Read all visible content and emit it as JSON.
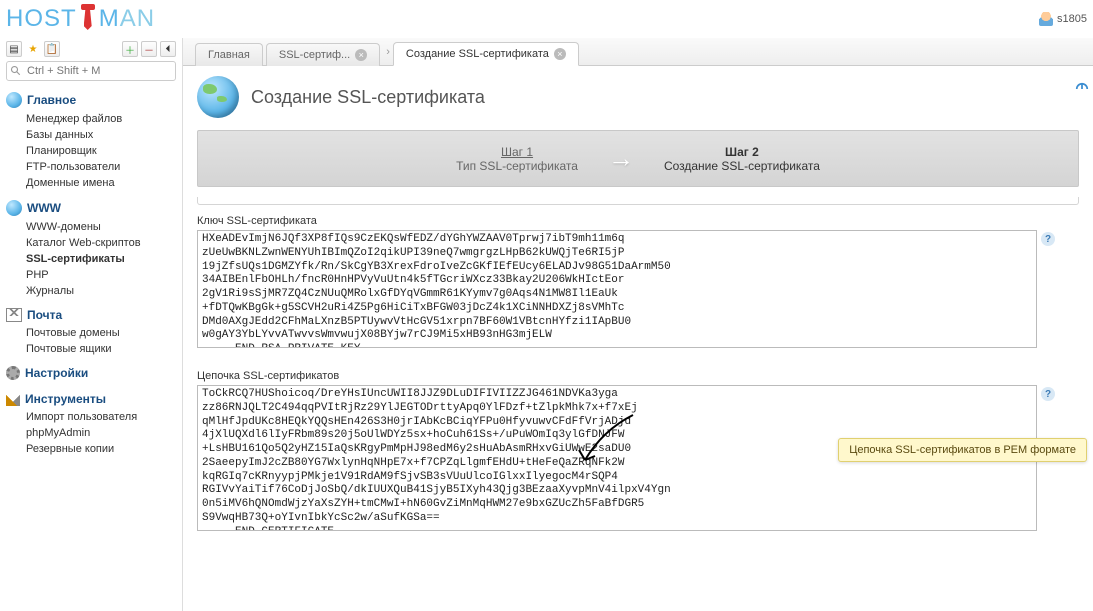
{
  "user": {
    "name": "s1805"
  },
  "search": {
    "placeholder": "Ctrl + Shift + M"
  },
  "nav": {
    "main": {
      "label": "Главное",
      "items": [
        "Менеджер файлов",
        "Базы данных",
        "Планировщик",
        "FTP-пользователи",
        "Доменные имена"
      ]
    },
    "www": {
      "label": "WWW",
      "items": [
        "WWW-домены",
        "Каталог Web-скриптов",
        "SSL-сертификаты",
        "PHP",
        "Журналы"
      ],
      "activeIndex": 2
    },
    "mail": {
      "label": "Почта",
      "items": [
        "Почтовые домены",
        "Почтовые ящики"
      ]
    },
    "settings": {
      "label": "Настройки"
    },
    "tools": {
      "label": "Инструменты",
      "items": [
        "Импорт пользователя",
        "phpMyAdmin",
        "Резервные копии"
      ]
    }
  },
  "tabs": {
    "t0": "Главная",
    "t1": "SSL-сертиф...",
    "t2": "Создание SSL-сертификата"
  },
  "page": {
    "title": "Создание SSL-сертификата"
  },
  "steps": {
    "s1": {
      "title": "Шаг 1",
      "sub": "Тип SSL-сертификата"
    },
    "s2": {
      "title": "Шаг 2",
      "sub": "Создание SSL-сертификата"
    }
  },
  "fields": {
    "key": {
      "label": "Ключ SSL-сертификата",
      "value": "HXeADEvImjN6JQf3XP8fIQs9CzEKQsWfEDZ/dYGhYWZAAV0Tprwj7ibT9mh11m6q\nzUeUwBKNLZwnWENYUhIBImQZoI2qikUPI39neQ7wmgrgzLHpB62kUWQjTe6RI5jP\n19jZfsUQs1DGMZYfk/Rn/SkCgYB3XrexFdroIveZcGKfIEfEUcy6ELADJv98G51DaArmM50\n34AIBEnlFbOHLh/fncR0HnHPVyVuUtn4k5fTGcriWXcz33Bkay2U206WkHIctEor\n2gV1Ri9sSjMR7ZQ4CzNUuQMRolxGfDYqVGmmR61KYymv7g0Aqs4N1MW8Il1EaUk\n+fDTQwKBgGk+g5SCVH2uRi4Z5Pg6HiCiTxBFGW03jDcZ4k1XCiNNHDXZj8sVMhTc\nDMd0AXgJEdd2CFhMaLXnzB5PTUywvVtHcGV51xrpn7BF60W1VBtcnHYfzi1IApBU0\nw0gAY3YbLYvvATwvvsWmvwujX08BYjw7rCJ9Mi5xHB93nHG3mjELW\n-----END RSA PRIVATE KEY-----"
    },
    "chain": {
      "label": "Цепочка SSL-сертификатов",
      "value": "ToCkRCQ7HUShoicoq/DreYHsIUncUWII8JJZ9DLuDIFIVIIZZJG461NDVKa3yga\nzz86RNJQLT2C494qqPVItRjRz29YlJEGTODrttyApq0YlFDzf+tZlpkMhk7x+f7xEj\nqMlHfJpdUKc8HEQkYQQsHEn426S3H0jrIAbKcBCiqYFPu0HfyvuwvCFdFfVrjADjd\n4jXlUQXdl6lIyFRbm89s20j5oUlWDYz5sx+hoCuh61Ss+/uPuWOmIq3ylGfDNJFW\n+LsHBU161Qo5Q2yHZ15IaQsKRgyPmMpHJ98edM6y2sHuAbAsmRHxvGiUWwE2saDU0\n2SaeepyImJ2cZB80YG7WxlynHqNHpE7x+f7CPZqLlgmfEHdU+tHeFeQaZRqNFk2W\nkqRGIq7cKRnyypjPMkje1V91RdAM9fSjvSB3sVUuUlcoIGlxxIlyegocM4rSQP4\nRGIVvYaiTif76CoDjJoSbQ/dkIUUXQuB41SjyB5IXyh43Qjg3BEzaaXyvpMnV4ilpxV4Ygn\n0n5iMV6hQNOmdWjzYaXsZYH+tmCMwI+hN60GvZiMnMqHWM27e9bxGZUcZh5FaBfDGR5\nS9VwqHB73Q+oYIvnIbkYcSc2w/aSufKGSa==\n-----END CERTIFICATE-----"
    }
  },
  "tooltip": "Цепочка SSL-сертификатов в PEM формате"
}
